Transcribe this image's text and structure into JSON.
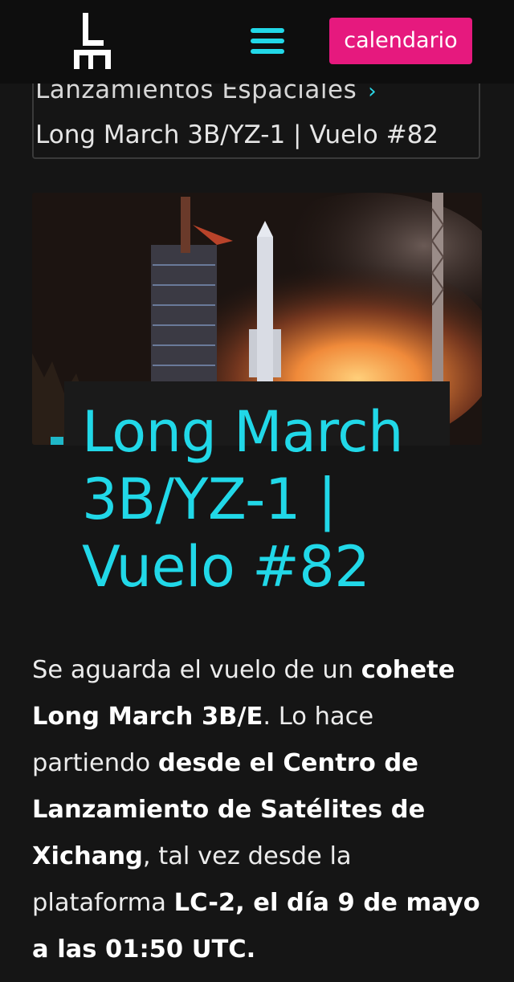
{
  "header": {
    "logo_icon": "le-logo-icon",
    "menu_icon": "hamburger-menu-icon",
    "calendar_button": "calendario",
    "accent": "#e6197e",
    "menu_color": "#22d8e8"
  },
  "breadcrumb": {
    "parent": "Lanzamientos Espaciales",
    "separator_icon": "chevron-right-icon",
    "separator": "›",
    "current": "Long March 3B/YZ-1 | Vuelo #82"
  },
  "hero": {
    "image_icon": "rocket-launch-photo",
    "title": "Long March 3B/YZ-1 | Vuelo #82",
    "title_color": "#21d8e8"
  },
  "article": {
    "segments": [
      {
        "text": "Se aguarda el vuelo de un ",
        "bold": false
      },
      {
        "text": "cohete Long March 3B/E",
        "bold": true
      },
      {
        "text": ". Lo hace partiendo ",
        "bold": false
      },
      {
        "text": "desde el Centro de Lanzamiento de Satélites de Xichang",
        "bold": true
      },
      {
        "text": ", tal vez desde la plataforma ",
        "bold": false
      },
      {
        "text": "LC-2, el día 9 de mayo a las 01:50 UTC.",
        "bold": true
      }
    ]
  }
}
